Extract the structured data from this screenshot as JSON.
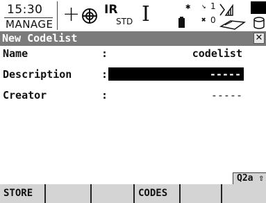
{
  "status": {
    "time": "15:30",
    "mode": "MANAGE",
    "reflector": "IR",
    "reflector_mode": "STD",
    "sat_count_top": "1",
    "sat_count_bottom": "0"
  },
  "window": {
    "title": "New Codelist",
    "close_glyph": "✕"
  },
  "form": {
    "name": {
      "label": "Name",
      "value": "codelist"
    },
    "description": {
      "label": "Description",
      "value": "-----"
    },
    "creator": {
      "label": "Creator",
      "value": "-----"
    },
    "colon": ":"
  },
  "input_mode": "Q2a ⇧",
  "softkeys": [
    "STORE",
    "",
    "",
    "CODES",
    "",
    ""
  ],
  "icons": [
    "plus-icon",
    "target-icon",
    "cursor-icon",
    "bluetooth-icon",
    "satellite-icon",
    "signal-icon",
    "card-icon",
    "battery-icon",
    "database-icon",
    "close-icon"
  ]
}
